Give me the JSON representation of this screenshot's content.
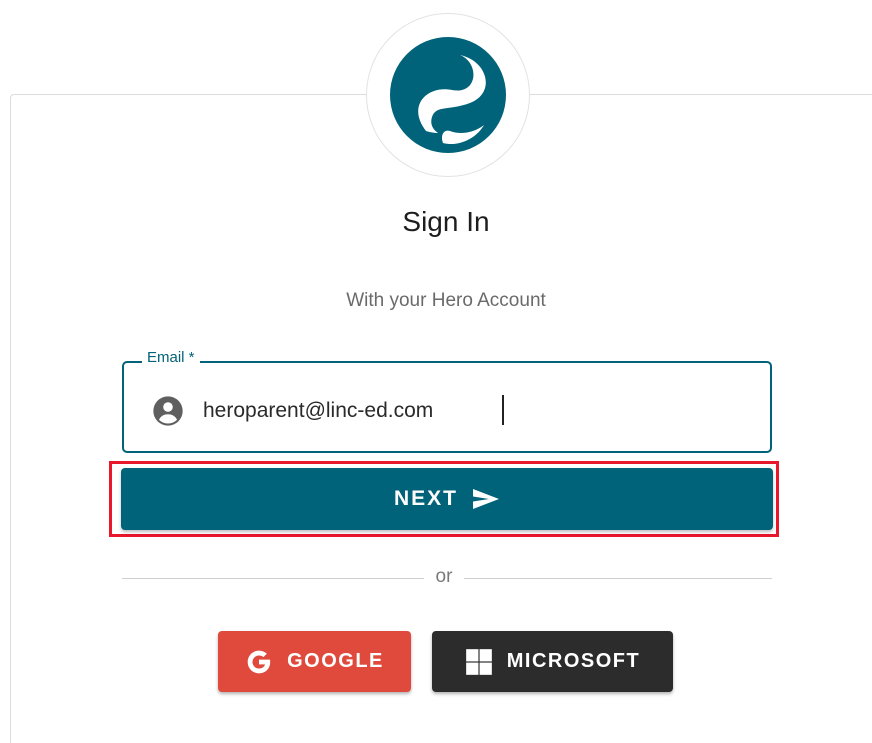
{
  "header": {
    "title": "Sign In",
    "subtitle": "With your Hero Account"
  },
  "email_field": {
    "label": "Email *",
    "value": "heroparent@linc-ed.com"
  },
  "next_button": {
    "label": "NEXT"
  },
  "divider": {
    "label": "or"
  },
  "social": {
    "google_label": "GOOGLE",
    "microsoft_label": "MICROSOFT"
  },
  "icons": {
    "logo": "hero-logo-icon",
    "person": "account-circle-icon",
    "send": "send-arrow-icon",
    "google": "google-g-icon",
    "microsoft": "windows-logo-icon"
  },
  "colors": {
    "brand": "#006379",
    "google": "#df4a3c",
    "microsoft": "#2c2c2c",
    "highlight": "#e8172c"
  }
}
